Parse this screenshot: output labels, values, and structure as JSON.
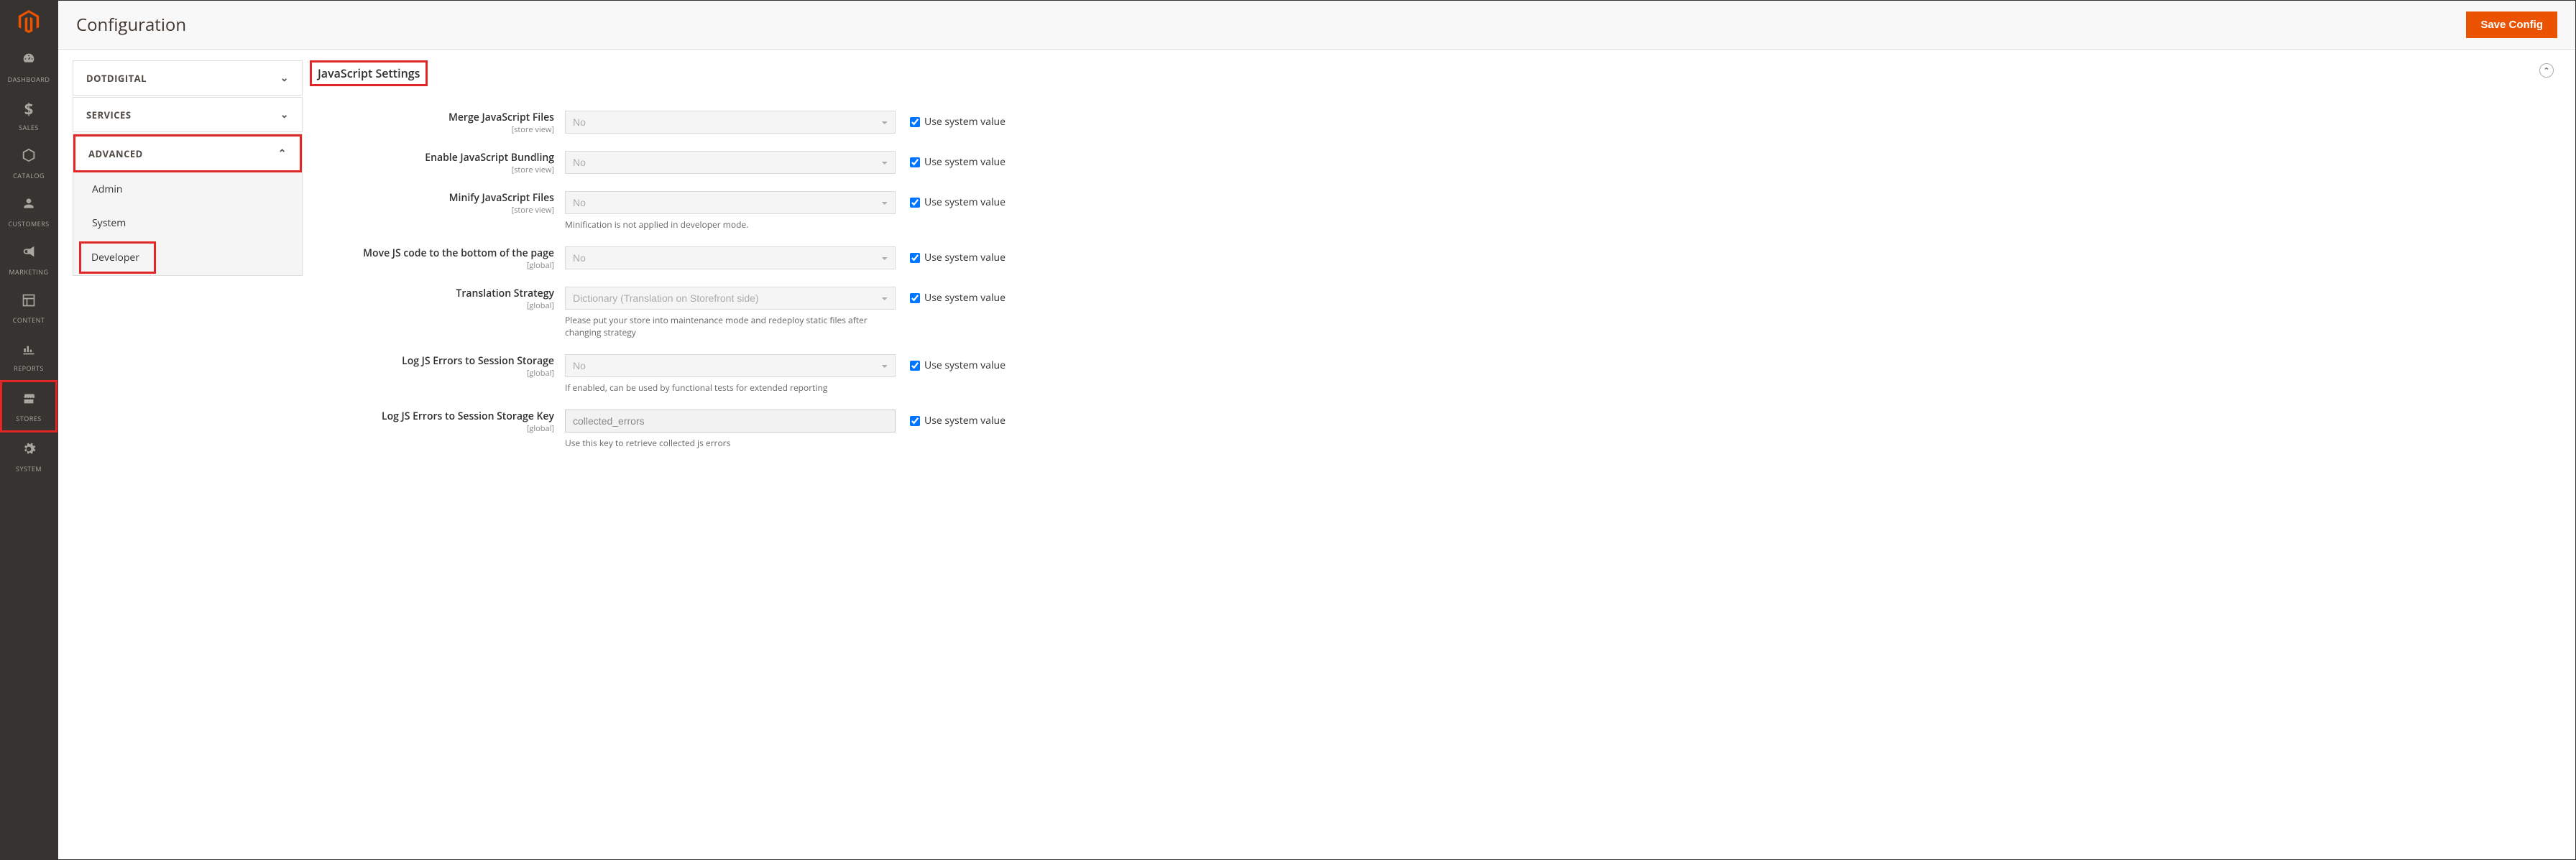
{
  "header": {
    "title": "Configuration",
    "save_label": "Save Config"
  },
  "sidebar": {
    "items": [
      {
        "label": "DASHBOARD"
      },
      {
        "label": "SALES"
      },
      {
        "label": "CATALOG"
      },
      {
        "label": "CUSTOMERS"
      },
      {
        "label": "MARKETING"
      },
      {
        "label": "CONTENT"
      },
      {
        "label": "REPORTS"
      },
      {
        "label": "STORES"
      },
      {
        "label": "SYSTEM"
      }
    ]
  },
  "tree": {
    "groups": [
      {
        "label": "DOTDIGITAL",
        "expanded": false
      },
      {
        "label": "SERVICES",
        "expanded": false
      },
      {
        "label": "ADVANCED",
        "expanded": true,
        "items": [
          {
            "label": "Admin"
          },
          {
            "label": "System"
          },
          {
            "label": "Developer"
          }
        ]
      }
    ]
  },
  "section": {
    "title": "JavaScript Settings",
    "use_system_label": "Use system value",
    "fields": [
      {
        "label": "Merge JavaScript Files",
        "scope": "[store view]",
        "value": "No"
      },
      {
        "label": "Enable JavaScript Bundling",
        "scope": "[store view]",
        "value": "No"
      },
      {
        "label": "Minify JavaScript Files",
        "scope": "[store view]",
        "value": "No",
        "note": "Minification is not applied in developer mode."
      },
      {
        "label": "Move JS code to the bottom of the page",
        "scope": "[global]",
        "value": "No"
      },
      {
        "label": "Translation Strategy",
        "scope": "[global]",
        "value": "Dictionary (Translation on Storefront side)",
        "note": "Please put your store into maintenance mode and redeploy static files after changing strategy"
      },
      {
        "label": "Log JS Errors to Session Storage",
        "scope": "[global]",
        "value": "No",
        "note": "If enabled, can be used by functional tests for extended reporting"
      },
      {
        "label": "Log JS Errors to Session Storage Key",
        "scope": "[global]",
        "value": "collected_errors",
        "type": "text",
        "note": "Use this key to retrieve collected js errors"
      }
    ]
  }
}
